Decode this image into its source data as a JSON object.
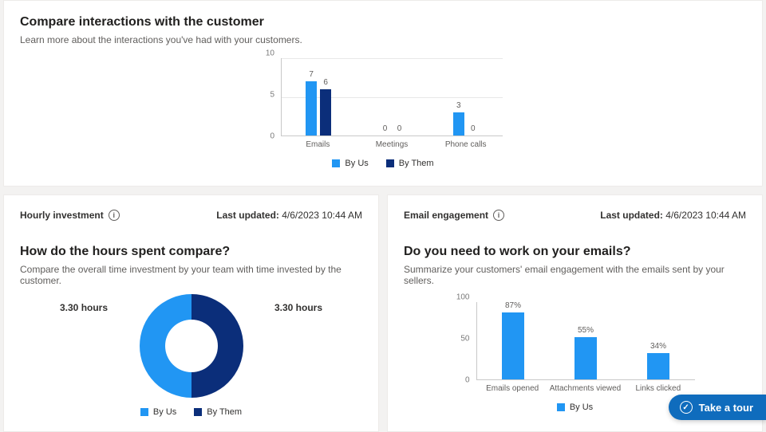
{
  "top": {
    "title": "Compare interactions with the customer",
    "subtitle": "Learn more about the interactions you've had with your customers."
  },
  "chart_data": [
    {
      "id": "interactions",
      "type": "bar",
      "categories": [
        "Emails",
        "Meetings",
        "Phone calls"
      ],
      "series": [
        {
          "name": "By Us",
          "color": "#2196f3",
          "values": [
            7,
            0,
            3
          ]
        },
        {
          "name": "By Them",
          "color": "#0b2e7a",
          "values": [
            6,
            0,
            0
          ]
        }
      ],
      "ylim": [
        0,
        10
      ],
      "yticks": [
        0,
        5,
        10
      ]
    },
    {
      "id": "hourly",
      "type": "pie",
      "series": [
        {
          "name": "By Us",
          "color": "#2196f3",
          "value": 3.3,
          "label": "3.30 hours"
        },
        {
          "name": "By Them",
          "color": "#0b2e7a",
          "value": 3.3,
          "label": "3.30 hours"
        }
      ]
    },
    {
      "id": "engagement",
      "type": "bar",
      "categories": [
        "Emails opened",
        "Attachments viewed",
        "Links clicked"
      ],
      "series": [
        {
          "name": "By Us",
          "color": "#2196f3",
          "values": [
            87,
            55,
            34
          ],
          "value_suffix": "%"
        }
      ],
      "ylim": [
        0,
        100
      ],
      "yticks": [
        0,
        50,
        100
      ]
    }
  ],
  "legend": {
    "by_us": "By Us",
    "by_them": "By Them"
  },
  "hourly": {
    "header": "Hourly investment",
    "last_updated_label": "Last updated:",
    "last_updated_value": "4/6/2023 10:44 AM",
    "title": "How do the hours spent compare?",
    "subtitle": "Compare the overall time investment by your team with time invested by the customer."
  },
  "engagement": {
    "header": "Email engagement",
    "last_updated_label": "Last updated:",
    "last_updated_value": "4/6/2023 10:44 AM",
    "title": "Do you need to work on your emails?",
    "subtitle": "Summarize your customers' email engagement with the emails sent by your sellers."
  },
  "tour_button": "Take a tour"
}
